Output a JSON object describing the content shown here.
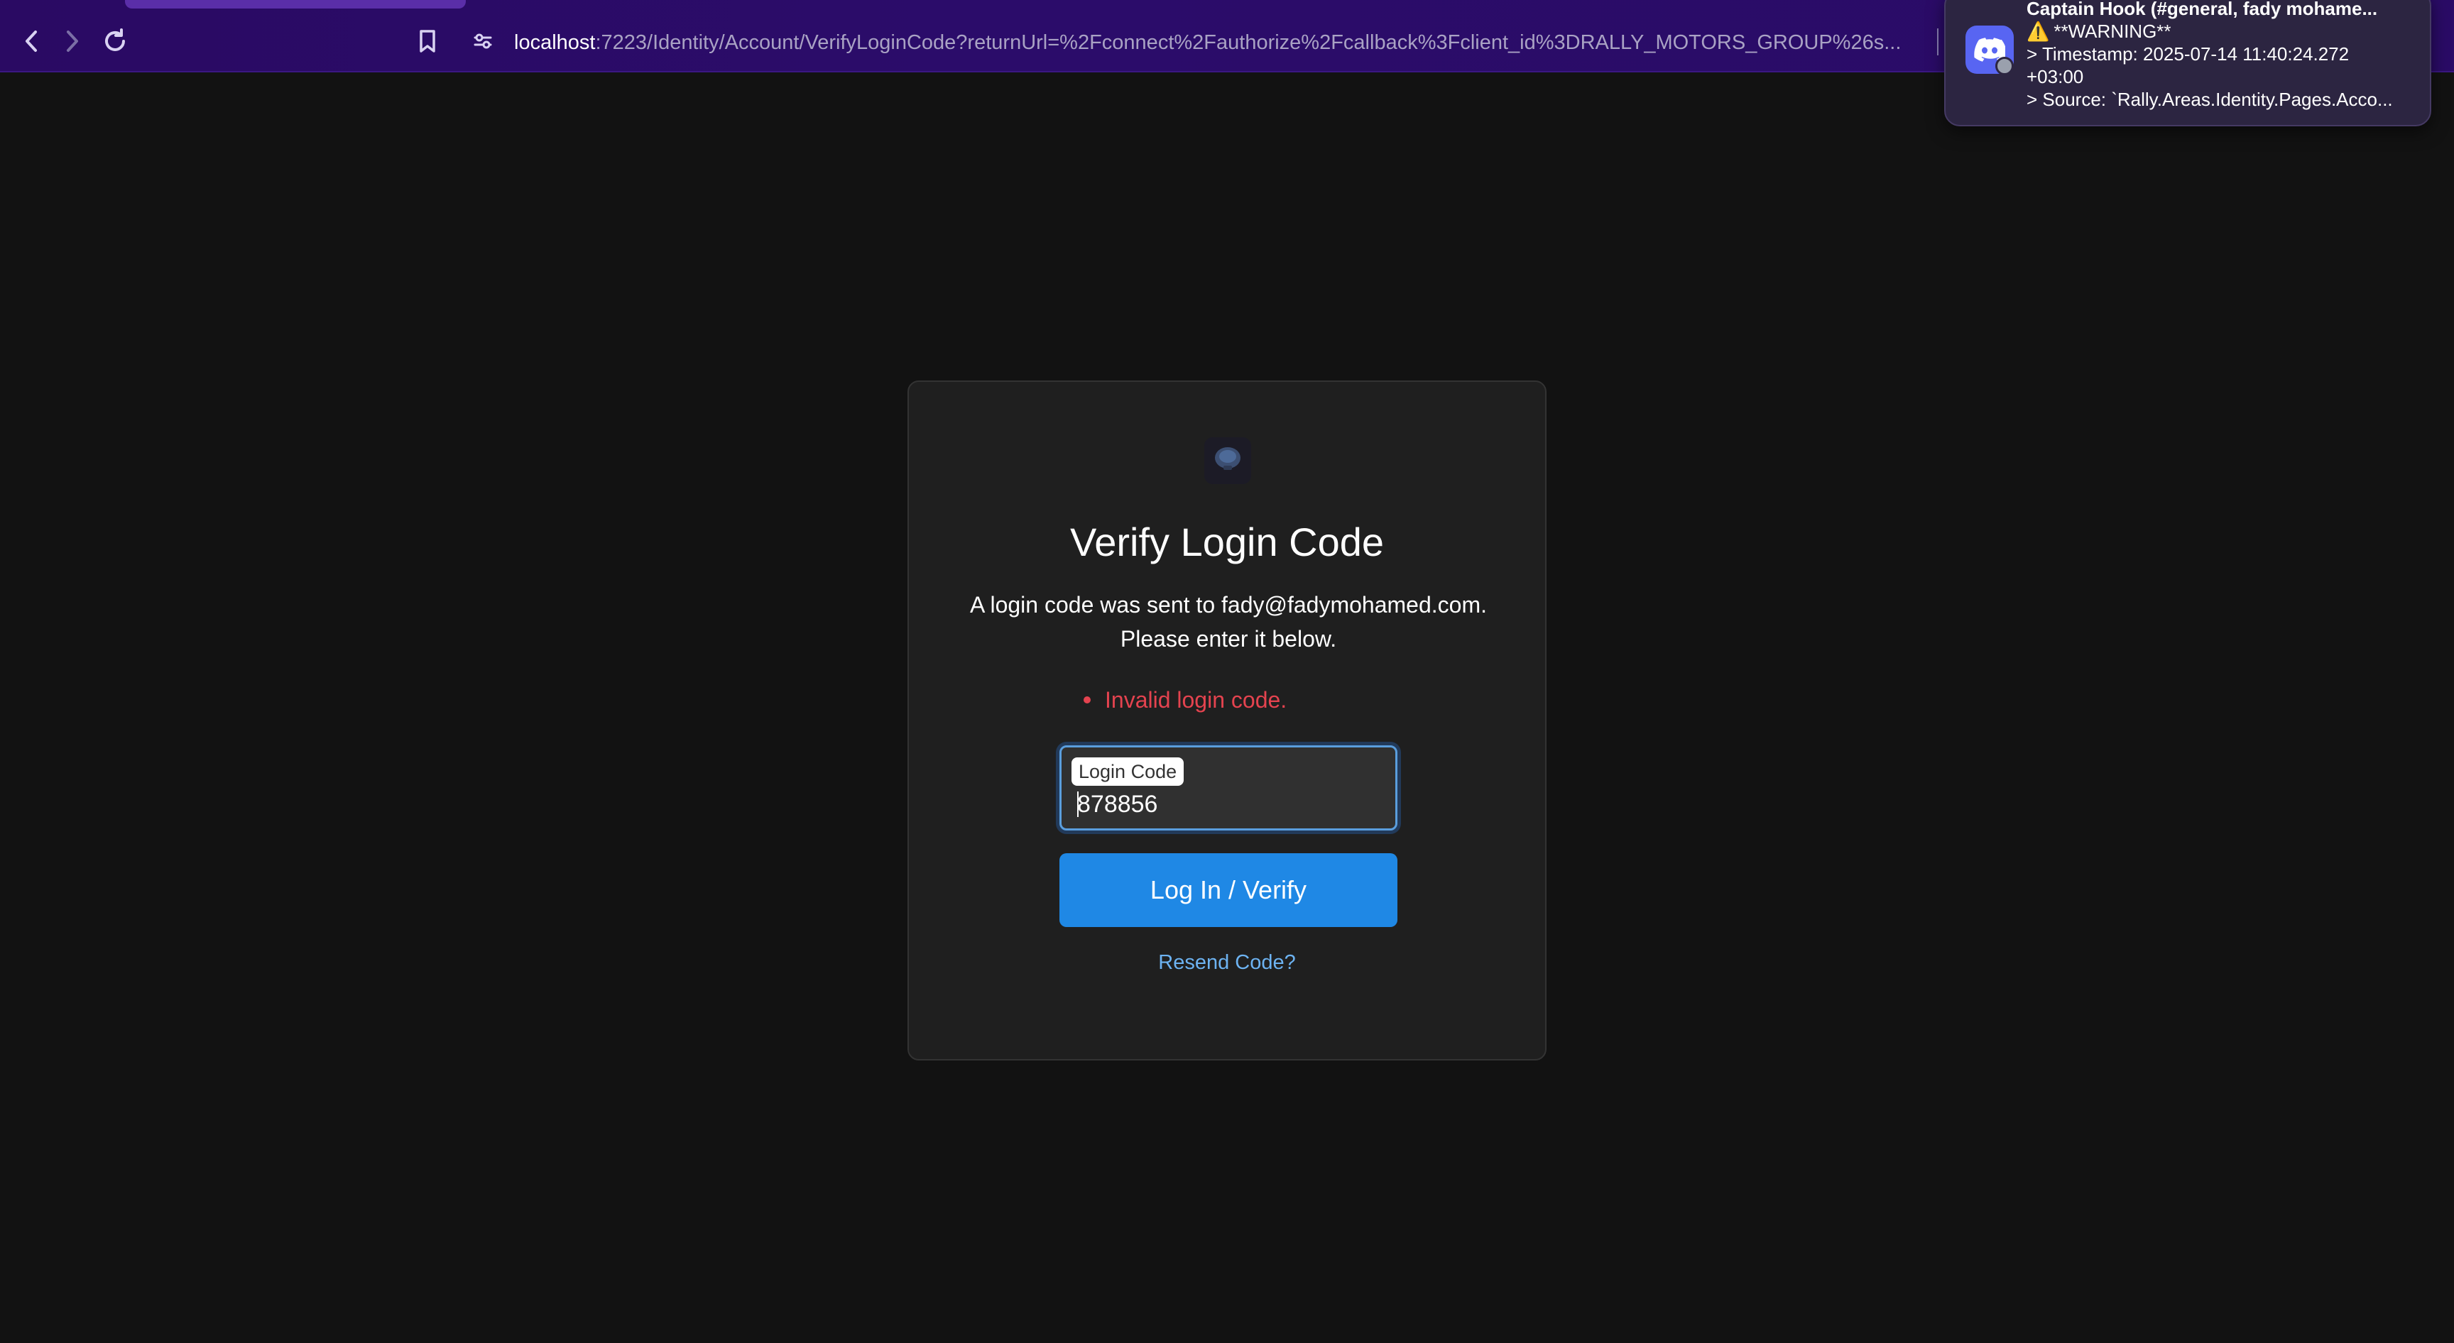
{
  "browser": {
    "url_host": "localhost",
    "url_rest": ":7223/Identity/Account/VerifyLoginCode?returnUrl=%2Fconnect%2Fauthorize%2Fcallback%3Fclient_id%3DRALLY_MOTORS_GROUP%26s...",
    "icons": {
      "back": "chevron-left-icon",
      "forward": "chevron-right-icon",
      "reload": "reload-icon",
      "bookmark": "bookmark-icon",
      "site_info": "tune-icon"
    }
  },
  "notification": {
    "app_icon": "discord-icon",
    "title": "Captain Hook (#general, fady mohame...",
    "warning_icon": "⚠️",
    "line1": "**WARNING**",
    "line2": "> Timestamp: 2025-07-14 11:40:24.272",
    "line3": "+03:00",
    "line4": "> Source: `Rally.Areas.Identity.Pages.Acco..."
  },
  "card": {
    "title": "Verify Login Code",
    "subtitle": "A login code was sent to fady@fadymohamed.com. Please enter it below.",
    "error": "Invalid login code.",
    "field_label": "Login Code",
    "field_value": "878856",
    "submit_label": "Log In / Verify",
    "resend_label": "Resend Code?"
  },
  "colors": {
    "background": "#121212",
    "card": "#1f1f1f",
    "primary": "#1f88e5",
    "error": "#e4434f",
    "link": "#6db3f2",
    "browser_bar": "#2a0a63",
    "discord": "#5865f2"
  }
}
